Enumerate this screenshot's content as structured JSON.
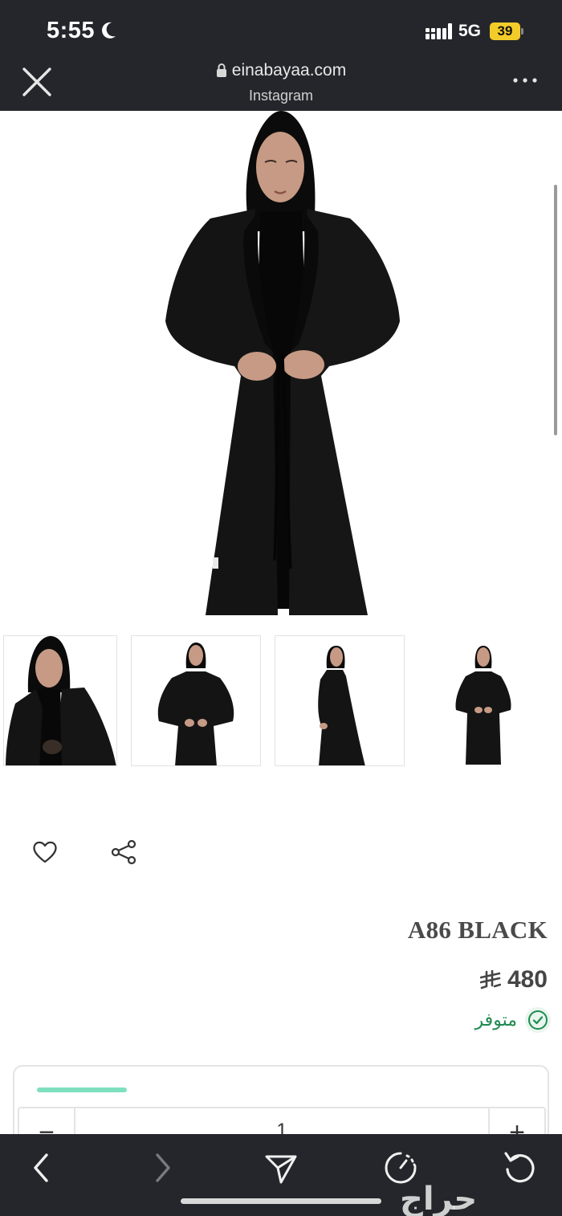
{
  "status_bar": {
    "time": "5:55",
    "network": "5G",
    "battery": "39"
  },
  "browser": {
    "domain": "einabayaa.com",
    "subtitle": "Instagram"
  },
  "product": {
    "title": "A86 BLACK",
    "price": "480",
    "currency_icon": "saudi-riyal-icon",
    "availability": "متوفر",
    "quantity": "1",
    "thumbnail_count": 4
  },
  "watermark": "حراج",
  "colors": {
    "chrome_bg": "#25262b",
    "battery": "#f4cc2a",
    "in_stock": "#1e8a4f",
    "accent": "#7ee0be",
    "title": "#4a4a4a"
  },
  "icons": [
    "close-icon",
    "lock-icon",
    "more-icon",
    "heart-icon",
    "share-icon",
    "check-circle-icon",
    "back-icon",
    "forward-icon",
    "send-icon",
    "timer-icon",
    "reload-icon"
  ]
}
